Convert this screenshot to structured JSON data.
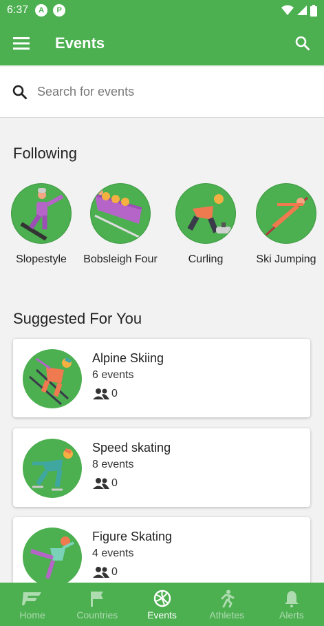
{
  "status_bar": {
    "time": "6:37",
    "icons": [
      "a-icon",
      "p-icon",
      "wifi-icon",
      "signal-icon",
      "battery-icon"
    ],
    "badge_a": "A",
    "badge_p": "P"
  },
  "app_bar": {
    "title": "Events",
    "icons": [
      "menu-icon",
      "search-icon"
    ]
  },
  "search": {
    "placeholder": "Search for events"
  },
  "following": {
    "title": "Following",
    "items": [
      {
        "label": "Slopestyle"
      },
      {
        "label": "Bobsleigh Four"
      },
      {
        "label": "Curling"
      },
      {
        "label": "Ski Jumping"
      }
    ]
  },
  "suggested": {
    "title": "Suggested For You",
    "cards": [
      {
        "title": "Alpine Skiing",
        "events": "6 events",
        "followers": "0"
      },
      {
        "title": "Speed skating",
        "events": "8 events",
        "followers": "0"
      },
      {
        "title": "Figure Skating",
        "events": "4 events",
        "followers": "0"
      }
    ]
  },
  "bottom_nav": {
    "items": [
      {
        "label": "Home",
        "icon": "home-logo-icon",
        "active": false
      },
      {
        "label": "Countries",
        "icon": "flag-icon",
        "active": false
      },
      {
        "label": "Events",
        "icon": "volleyball-icon",
        "active": true
      },
      {
        "label": "Athletes",
        "icon": "running-icon",
        "active": false
      },
      {
        "label": "Alerts",
        "icon": "bell-icon",
        "active": false
      }
    ]
  },
  "colors": {
    "primary": "#4caf50",
    "background": "#f2f2f2",
    "card": "#ffffff"
  }
}
